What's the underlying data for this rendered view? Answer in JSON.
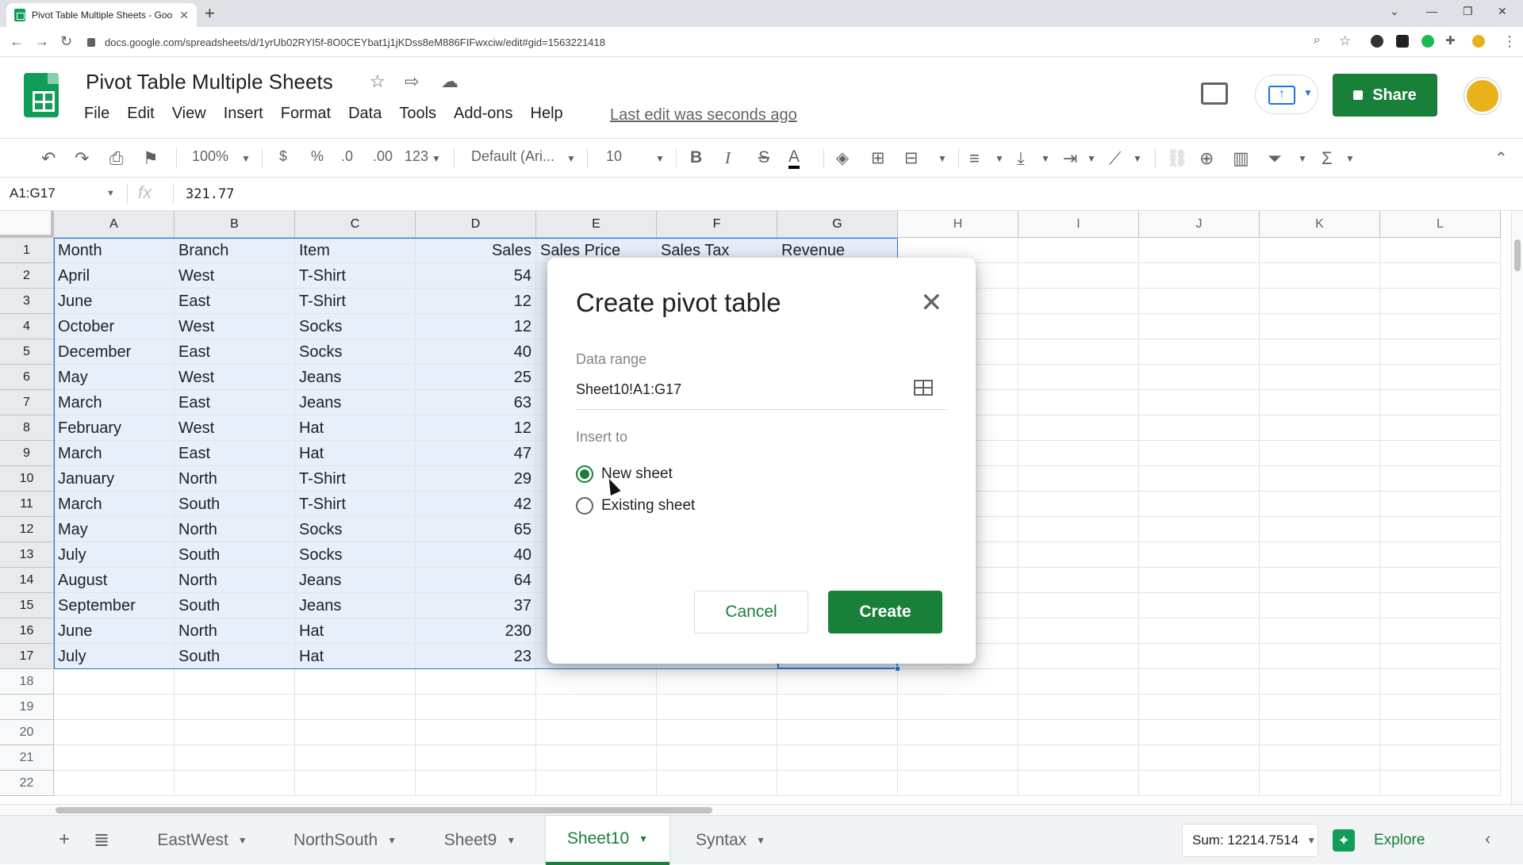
{
  "browser": {
    "tab_title": "Pivot Table Multiple Sheets - Goo",
    "url": "docs.google.com/spreadsheets/d/1yrUb02RYI5f-8O0CEYbat1j1jKDss8eM886FIFwxciw/edit#gid=1563221418"
  },
  "doc": {
    "title": "Pivot Table Multiple Sheets",
    "menus": [
      "File",
      "Edit",
      "View",
      "Insert",
      "Format",
      "Data",
      "Tools",
      "Add-ons",
      "Help"
    ],
    "last_edit": "Last edit was seconds ago",
    "share_label": "Share"
  },
  "toolbar": {
    "zoom": "100%",
    "currency": "$",
    "percent": "%",
    "decrease_decimal": ".0",
    "increase_decimal": ".00",
    "number_format": "123",
    "font": "Default (Ari...",
    "font_size": "10",
    "bold": "B",
    "italic": "I",
    "strike": "S",
    "text_color": "A"
  },
  "formula_bar": {
    "name_box": "A1:G17",
    "fx": "fx",
    "value": "321.77"
  },
  "grid": {
    "columns": [
      "A",
      "B",
      "C",
      "D",
      "E",
      "F",
      "G",
      "H",
      "I",
      "J",
      "K",
      "L"
    ],
    "rows": [
      "1",
      "2",
      "3",
      "4",
      "5",
      "6",
      "7",
      "8",
      "9",
      "10",
      "11",
      "12",
      "13",
      "14",
      "15",
      "16",
      "17",
      "18",
      "19",
      "20",
      "21",
      "22"
    ],
    "header_row": [
      "Month",
      "Branch",
      "Item",
      "Sales",
      "Sales Price",
      "Sales Tax",
      "Revenue"
    ],
    "data": [
      [
        "April",
        "West",
        "T-Shirt",
        "54"
      ],
      [
        "June",
        "East",
        "T-Shirt",
        "12"
      ],
      [
        "October",
        "West",
        "Socks",
        "12"
      ],
      [
        "December",
        "East",
        "Socks",
        "40"
      ],
      [
        "May",
        "West",
        "Jeans",
        "25"
      ],
      [
        "March",
        "East",
        "Jeans",
        "63"
      ],
      [
        "February",
        "West",
        "Hat",
        "12"
      ],
      [
        "March",
        "East",
        "Hat",
        "47"
      ],
      [
        "January",
        "North",
        "T-Shirt",
        "29"
      ],
      [
        "March",
        "South",
        "T-Shirt",
        "42"
      ],
      [
        "May",
        "North",
        "Socks",
        "65"
      ],
      [
        "July",
        "South",
        "Socks",
        "40"
      ],
      [
        "August",
        "North",
        "Jeans",
        "64"
      ],
      [
        "September",
        "South",
        "Jeans",
        "37"
      ],
      [
        "June",
        "North",
        "Hat",
        "230"
      ],
      [
        "July",
        "South",
        "Hat",
        "23"
      ]
    ]
  },
  "sheets": {
    "tabs": [
      "EastWest",
      "NorthSouth",
      "Sheet9",
      "Sheet10",
      "Syntax"
    ],
    "active": "Sheet10",
    "sum": "Sum: 12214.7514",
    "explore": "Explore"
  },
  "dialog": {
    "title": "Create pivot table",
    "data_range_label": "Data range",
    "data_range_value": "Sheet10!A1:G17",
    "insert_to_label": "Insert to",
    "option_new": "New sheet",
    "option_existing": "Existing sheet",
    "selected_option": "New sheet",
    "cancel": "Cancel",
    "create": "Create"
  },
  "colors": {
    "accent_green": "#188038",
    "selection_blue": "#1a73e8",
    "range_fill": "#e7effb"
  }
}
